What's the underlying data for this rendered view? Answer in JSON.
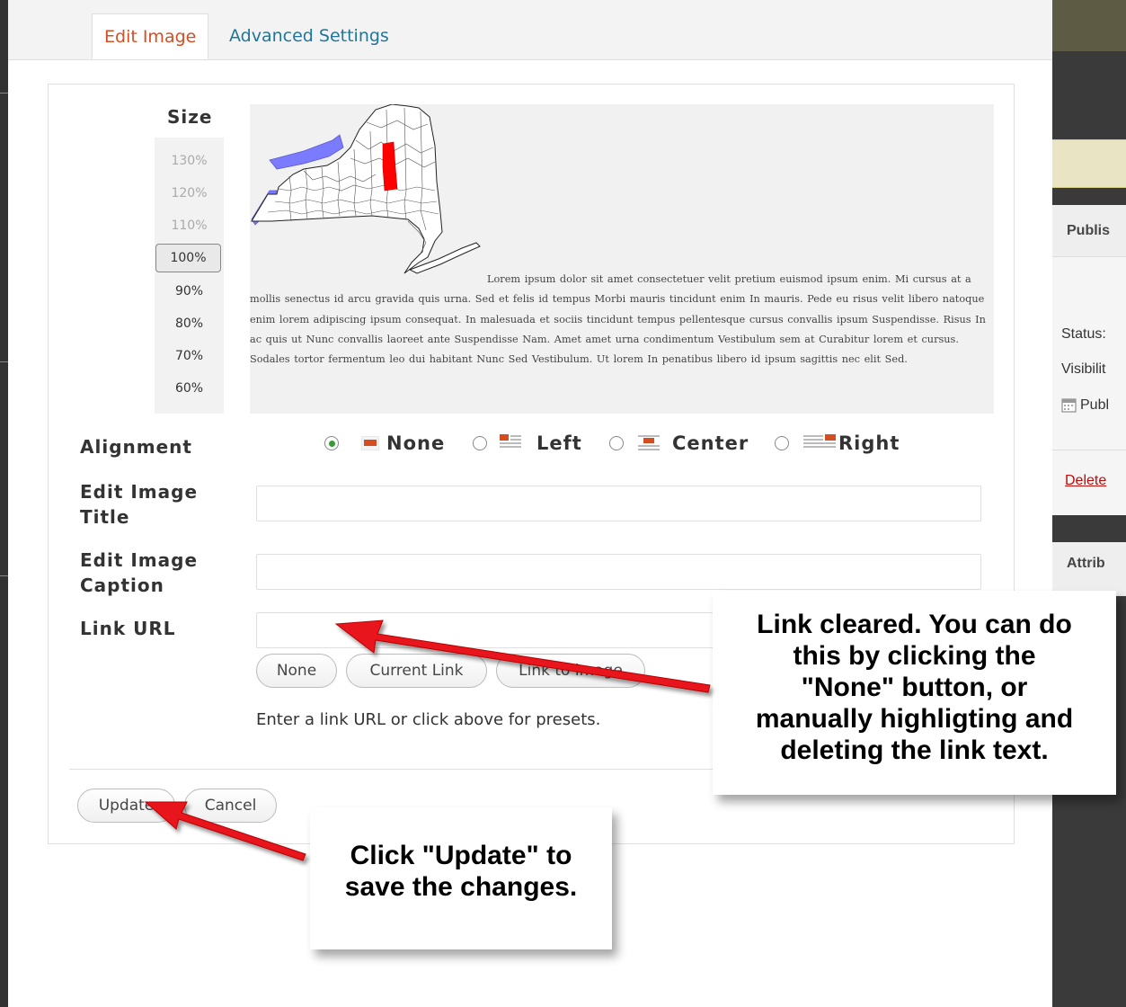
{
  "tabs": [
    {
      "label": "Edit Image"
    },
    {
      "label": "Advanced Settings"
    }
  ],
  "size": {
    "label": "Size",
    "options": [
      "130%",
      "120%",
      "110%",
      "100%",
      "90%",
      "80%",
      "70%",
      "60%"
    ],
    "selected": "100%"
  },
  "preview": {
    "text": "Lorem ipsum dolor sit amet consectetuer velit pretium euismod ipsum enim. Mi cursus at a mollis senectus id arcu gravida quis urna. Sed et felis id tempus Morbi mauris tincidunt enim In mauris. Pede eu risus velit libero natoque enim lorem adipiscing ipsum consequat. In malesuada et sociis tincidunt tempus pellentesque cursus convallis ipsum Suspendisse. Risus In ac quis ut Nunc convallis laoreet ante Suspendisse Nam. Amet amet urna condimentum Vestibulum sem at Curabitur lorem et cursus. Sodales tortor fermentum leo dui habitant Nunc Sed Vestibulum. Ut lorem In penatibus libero id ipsum sagittis nec elit Sed."
  },
  "alignment": {
    "label": "Alignment",
    "options": [
      {
        "label": "None",
        "icon": "align-none-icon"
      },
      {
        "label": "Left",
        "icon": "align-left-icon"
      },
      {
        "label": "Center",
        "icon": "align-center-icon"
      },
      {
        "label": "Right",
        "icon": "align-right-icon"
      }
    ],
    "selected": "None"
  },
  "fields": {
    "title_label_1": "Edit Image",
    "title_label_2": "Title",
    "title_value": "",
    "caption_label_1": "Edit Image",
    "caption_label_2": "Caption",
    "caption_value": "",
    "link_label": "Link URL",
    "link_value": ""
  },
  "link_buttons": [
    "None",
    "Current Link",
    "Link to image"
  ],
  "helper_text": "Enter a link URL or click above for presets.",
  "actions": {
    "update": "Update",
    "cancel": "Cancel"
  },
  "callouts": {
    "link": [
      "Link cleared. You can do",
      "this by clicking the",
      "\"None\" button, or",
      "manually highligting and",
      "deleting the link text."
    ],
    "update": [
      "Click \"Update\" to",
      "save the changes."
    ]
  },
  "background": {
    "publish": "Publis",
    "status": "Status:",
    "visibility": "Visibilit",
    "published": "Publ",
    "delete": "Delete",
    "attributes": "Attrib"
  },
  "colors": {
    "tab_active": "#d54e21",
    "tab_link": "#21759b",
    "highlight_county": "#ff0000",
    "lake": "#7b7bff",
    "arrow": "#e8171b"
  }
}
